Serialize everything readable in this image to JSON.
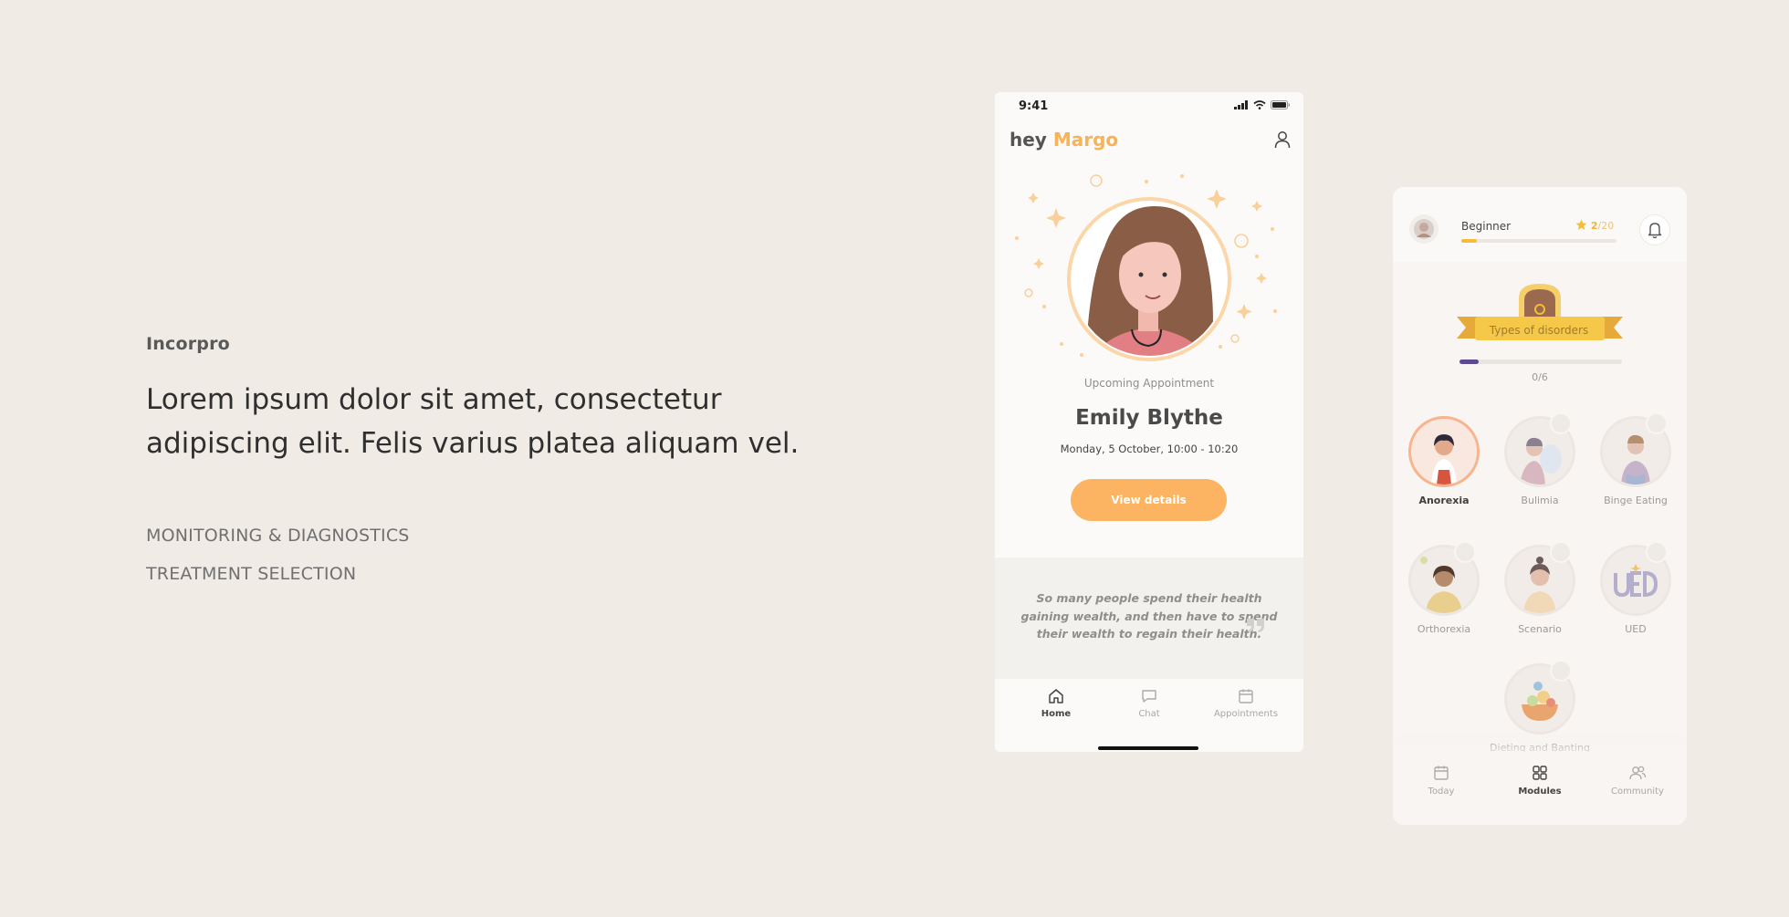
{
  "intro": {
    "brand": "Incorpro",
    "headline_line1": "Lorem ipsum dolor sit amet, consectetur",
    "headline_line2": "adipiscing elit. Felis varius platea aliquam vel.",
    "features": [
      "MONITORING & DIAGNOSTICS",
      "TREATMENT SELECTION"
    ]
  },
  "phone_home": {
    "status_time": "9:41",
    "greeting": "hey",
    "user_name": "Margo",
    "upcoming_label": "Upcoming Appointment",
    "doctor_name": "Emily Blythe",
    "appointment_time": "Monday, 5 October, 10:00 - 10:20",
    "view_button": "View details",
    "quote": "So many people spend their health gaining wealth, and then have to spend their wealth to regain their health.",
    "tabs": [
      {
        "label": "Home",
        "icon": "home-icon",
        "active": true
      },
      {
        "label": "Chat",
        "icon": "chat-icon",
        "active": false
      },
      {
        "label": "Appointments",
        "icon": "calendar-icon",
        "active": false
      }
    ],
    "colors": {
      "accent": "#fdb462",
      "background": "#fbfaf8"
    }
  },
  "phone_modules": {
    "level": "Beginner",
    "score": "2",
    "score_total": "/20",
    "level_progress": 0.1,
    "banner_label": "Types of disorders",
    "module_progress": 0.12,
    "module_progress_text": "0/6",
    "modules": [
      {
        "label": "Anorexia",
        "active": true
      },
      {
        "label": "Bulimia",
        "active": false
      },
      {
        "label": "Binge Eating",
        "active": false
      },
      {
        "label": "Orthorexia",
        "active": false
      },
      {
        "label": "Scenario",
        "active": false
      },
      {
        "label": "UED",
        "active": false
      },
      {
        "label": "Dieting and Banting",
        "active": false
      }
    ],
    "tabs": [
      {
        "label": "Today",
        "icon": "calendar-icon",
        "active": false
      },
      {
        "label": "Modules",
        "icon": "grid-icon",
        "active": true
      },
      {
        "label": "Community",
        "icon": "users-icon",
        "active": false
      }
    ],
    "colors": {
      "level_bar": "#f5be34",
      "module_bar": "#5e4b8f",
      "star": "#f5b235"
    }
  }
}
